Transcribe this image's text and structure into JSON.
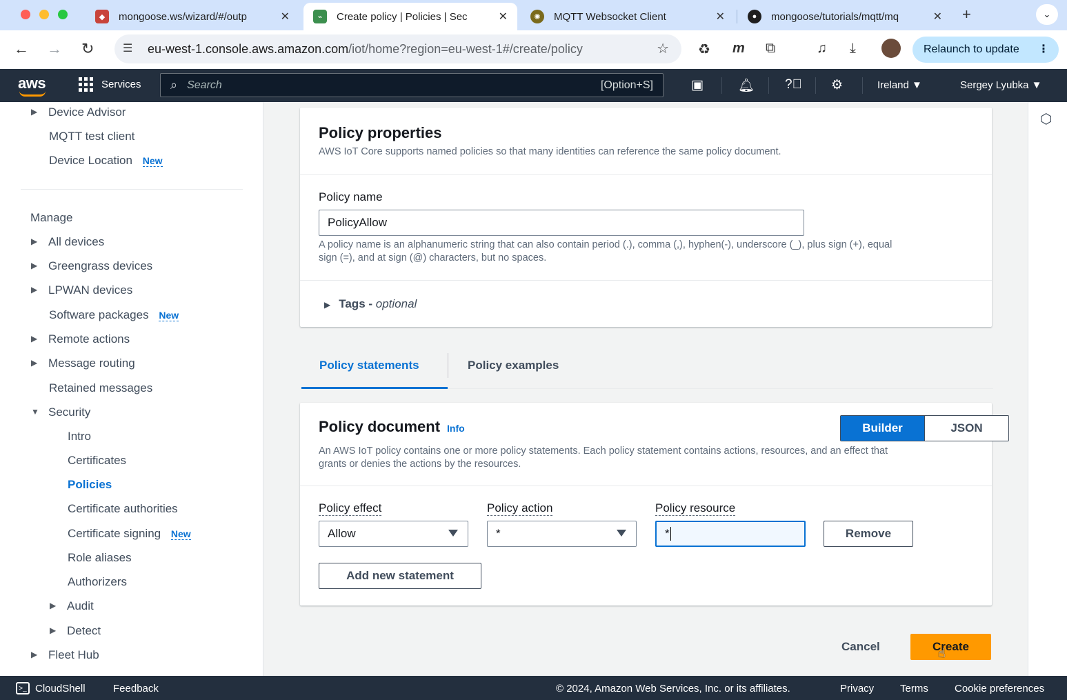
{
  "browser": {
    "tabs": [
      {
        "title": "mongoose.ws/wizard/#/outp",
        "favicon": "mongoose-icon",
        "color": "#c8443b"
      },
      {
        "title": "Create policy | Policies | Sec",
        "favicon": "aws-iot-icon",
        "color": "#3c8f4e"
      },
      {
        "title": "MQTT Websocket Client",
        "favicon": "mqtt-icon",
        "color": "#7a6a1c"
      },
      {
        "title": "mongoose/tutorials/mqtt/mq",
        "favicon": "github-icon",
        "color": "#1f1f1f"
      }
    ],
    "url_host": "eu-west-1.console.aws.amazon.com",
    "url_path": "/iot/home?region=eu-west-1#/create/policy",
    "relaunch_label": "Relaunch to update"
  },
  "aws_header": {
    "logo": "aws",
    "services_label": "Services",
    "search_placeholder": "Search",
    "search_shortcut": "[Option+S]",
    "region": "Ireland",
    "user": "Sergey Lyubka"
  },
  "sidebar": {
    "top_items": [
      {
        "label": "Device Advisor",
        "expandable": true
      },
      {
        "label": "MQTT test client",
        "expandable": false
      },
      {
        "label": "Device Location",
        "expandable": false,
        "badge": "New"
      }
    ],
    "manage_heading": "Manage",
    "manage_items": [
      {
        "label": "All devices",
        "expandable": true
      },
      {
        "label": "Greengrass devices",
        "expandable": true
      },
      {
        "label": "LPWAN devices",
        "expandable": true
      },
      {
        "label": "Software packages",
        "expandable": false,
        "badge": "New"
      },
      {
        "label": "Remote actions",
        "expandable": true
      },
      {
        "label": "Message routing",
        "expandable": true
      },
      {
        "label": "Retained messages",
        "expandable": false
      },
      {
        "label": "Security",
        "expandable": true,
        "expanded": true
      }
    ],
    "security_items": [
      {
        "label": "Intro"
      },
      {
        "label": "Certificates"
      },
      {
        "label": "Policies",
        "active": true
      },
      {
        "label": "Certificate authorities"
      },
      {
        "label": "Certificate signing",
        "badge": "New"
      },
      {
        "label": "Role aliases"
      },
      {
        "label": "Authorizers"
      },
      {
        "label": "Audit",
        "expandable": true
      },
      {
        "label": "Detect",
        "expandable": true
      }
    ],
    "bottom_items": [
      {
        "label": "Fleet Hub",
        "expandable": true
      }
    ]
  },
  "properties": {
    "title": "Policy properties",
    "description": "AWS IoT Core supports named policies so that many identities can reference the same policy document.",
    "name_label": "Policy name",
    "name_value": "PolicyAllow",
    "name_hint_1": "A policy name is an alphanumeric string that can also contain period (.), comma (,), hyphen(-), underscore (_), plus sign (+), equal",
    "name_hint_2": "sign (=), and at sign (@) characters, but no spaces.",
    "tags_label": "Tags - ",
    "tags_optional": "optional"
  },
  "tabs": {
    "statements": "Policy statements",
    "examples": "Policy examples"
  },
  "document": {
    "title": "Policy document",
    "info": "Info",
    "builder": "Builder",
    "json": "JSON",
    "description_1": "An AWS IoT policy contains one or more policy statements. Each policy statement contains actions, resources, and an effect that",
    "description_2": "grants or denies the actions by the resources.",
    "effect_label": "Policy effect",
    "effect_value": "Allow",
    "action_label": "Policy action",
    "action_value": "*",
    "resource_label": "Policy resource",
    "resource_value": "*",
    "remove": "Remove",
    "add_statement": "Add new statement"
  },
  "actions": {
    "cancel": "Cancel",
    "create": "Create"
  },
  "footer": {
    "cloudshell": "CloudShell",
    "feedback": "Feedback",
    "copyright": "© 2024, Amazon Web Services, Inc. or its affiliates.",
    "privacy": "Privacy",
    "terms": "Terms",
    "cookies": "Cookie preferences"
  },
  "colors": {
    "accent": "#0972d3",
    "create_button": "#ff9900",
    "aws_header": "#232f3e"
  }
}
